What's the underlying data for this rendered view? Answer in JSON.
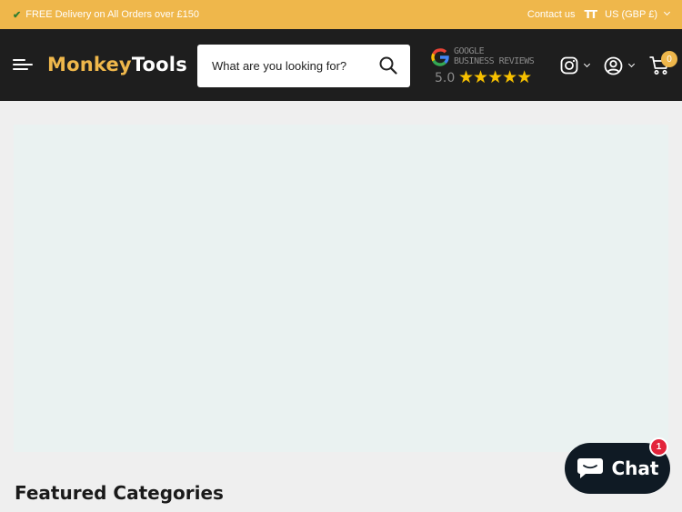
{
  "announcement": {
    "check_icon": "check-icon",
    "text": "FREE Delivery on All Orders over £150",
    "contact_label": "Contact us",
    "text_size_icon": "text-size-icon",
    "text_size_glyph": "TT",
    "currency_label": "US (GBP £)"
  },
  "header": {
    "menu_icon": "hamburger-menu-icon",
    "logo": {
      "part1": "Monkey",
      "part2": "Tools"
    },
    "search": {
      "placeholder": "What are you looking for?"
    },
    "reviews": {
      "line1": "GOOGLE",
      "line2": "BUSINESS REVIEWS",
      "score": "5.0",
      "stars": "★★★★★"
    },
    "cart_count": "0"
  },
  "main": {
    "featured_title": "Featured Categories"
  },
  "chat": {
    "label": "Chat",
    "badge": "1"
  },
  "colors": {
    "accent": "#efb74b",
    "header_bg": "#1e1e1e",
    "chat_bg": "#0f1a24",
    "badge_red": "#e3243b"
  }
}
